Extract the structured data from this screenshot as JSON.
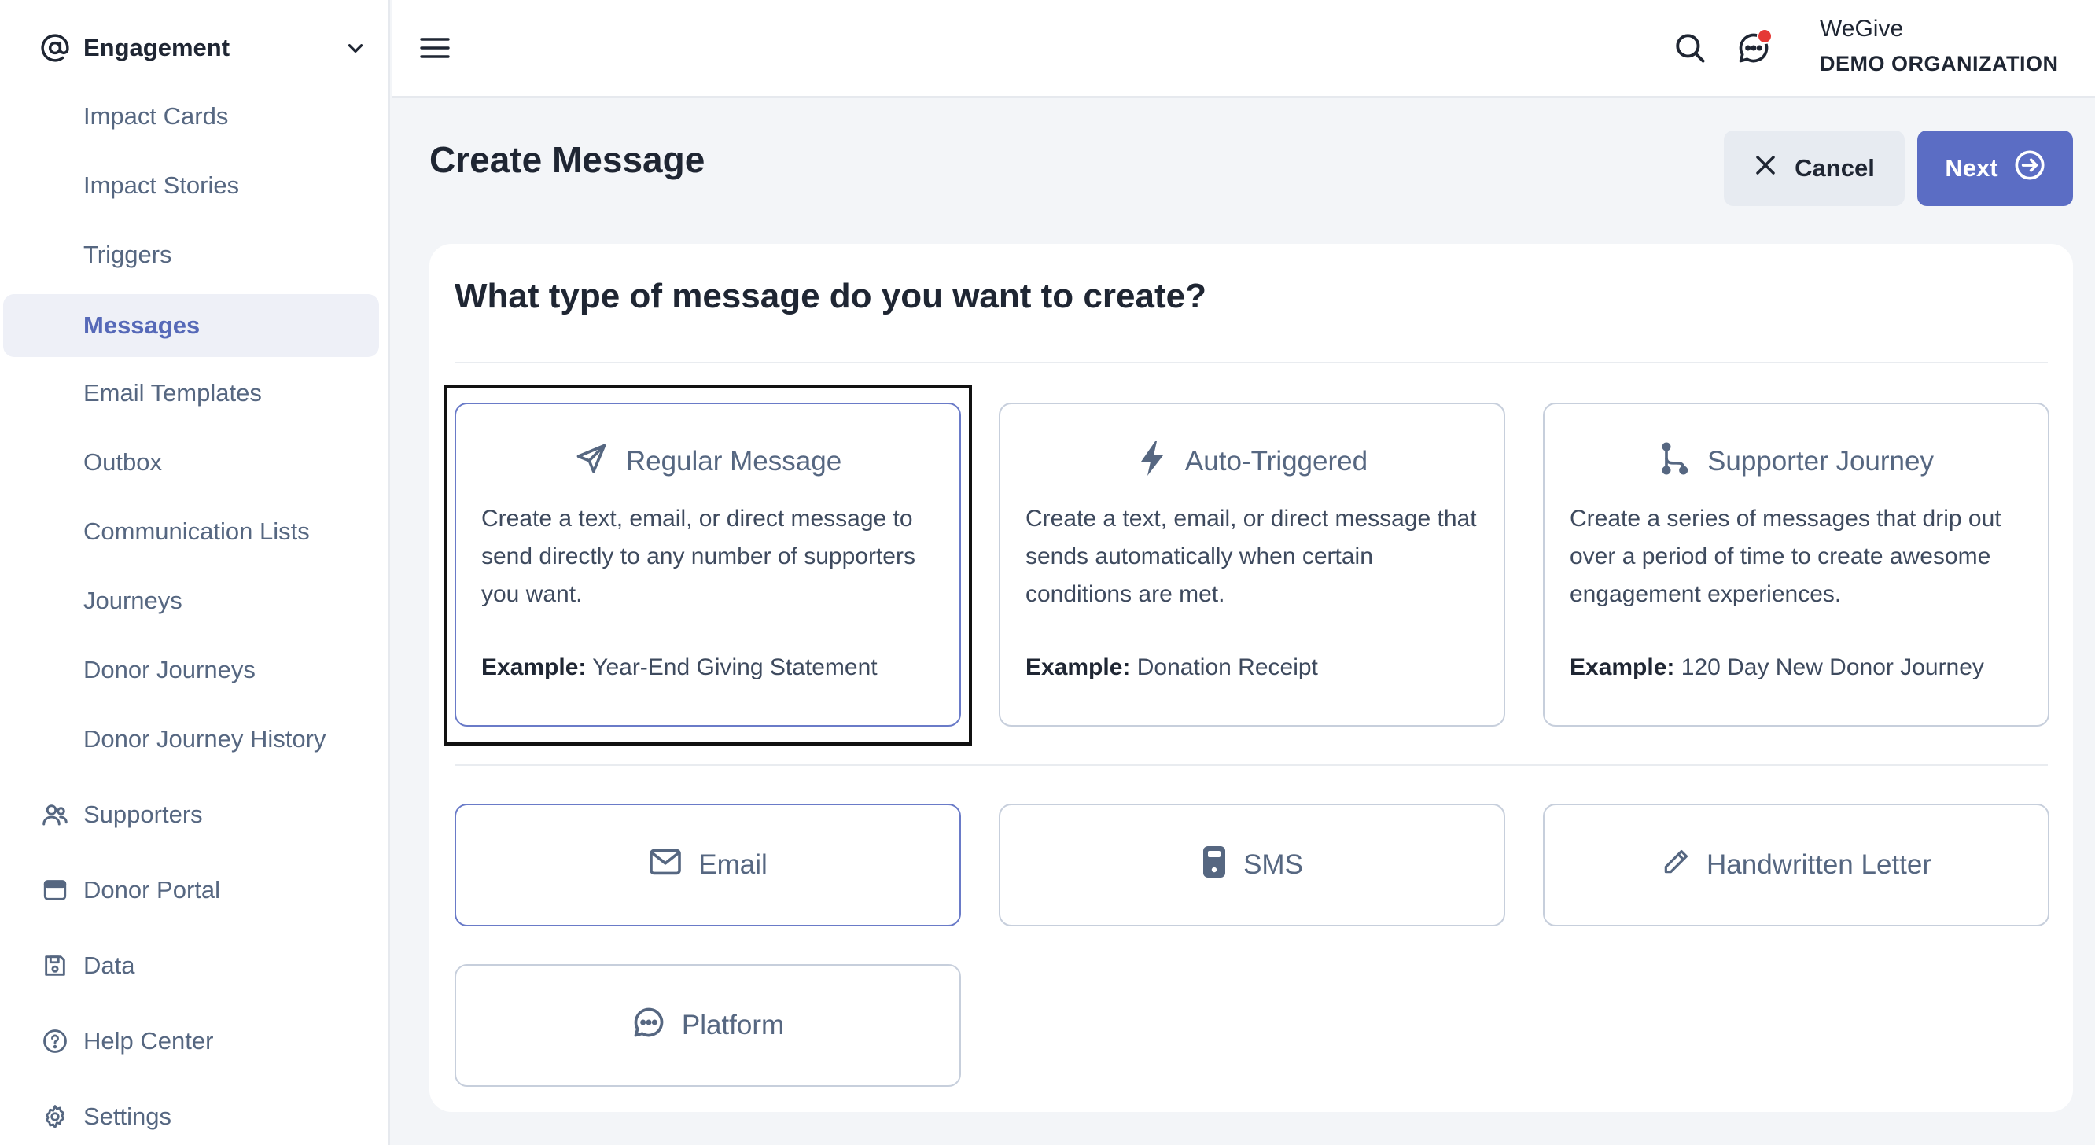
{
  "sidebar": {
    "section": {
      "label": "Engagement",
      "icon": "at-icon"
    },
    "sub_items": [
      {
        "label": "Impact Cards",
        "active": false
      },
      {
        "label": "Impact Stories",
        "active": false
      },
      {
        "label": "Triggers",
        "active": false
      },
      {
        "label": "Messages",
        "active": true
      },
      {
        "label": "Email Templates",
        "active": false
      },
      {
        "label": "Outbox",
        "active": false
      },
      {
        "label": "Communication Lists",
        "active": false
      },
      {
        "label": "Journeys",
        "active": false
      },
      {
        "label": "Donor Journeys",
        "active": false
      },
      {
        "label": "Donor Journey History",
        "active": false
      }
    ],
    "main_items": [
      {
        "label": "Supporters",
        "icon": "users-icon"
      },
      {
        "label": "Donor Portal",
        "icon": "browser-window-icon"
      },
      {
        "label": "Data",
        "icon": "floppy-disk-icon"
      },
      {
        "label": "Help Center",
        "icon": "question-circle-icon"
      },
      {
        "label": "Settings",
        "icon": "gear-icon"
      }
    ]
  },
  "topbar": {
    "org_name": "WeGive",
    "org_sub": "DEMO ORGANIZATION"
  },
  "header": {
    "title": "Create Message",
    "cancel_label": "Cancel",
    "next_label": "Next"
  },
  "card": {
    "question": "What type of message do you want to create?",
    "example_prefix": "Example:",
    "types": [
      {
        "title": "Regular Message",
        "icon": "paper-plane-icon",
        "description": "Create a text, email, or direct message to send directly to any number of supporters you want.",
        "example": "Year-End Giving Statement",
        "selected": true
      },
      {
        "title": "Auto-Triggered",
        "icon": "lightning-bolt-icon",
        "description": "Create a text, email, or direct message that sends automatically when certain conditions are met.",
        "example": "Donation Receipt",
        "selected": false
      },
      {
        "title": "Supporter Journey",
        "icon": "journey-path-icon",
        "description": "Create a series of messages that drip out over a period of time to create awesome engagement experiences.",
        "example": "120 Day New Donor Journey",
        "selected": false
      }
    ],
    "channels": [
      {
        "label": "Email",
        "icon": "envelope-icon",
        "selected": true
      },
      {
        "label": "SMS",
        "icon": "phone-icon",
        "selected": false
      },
      {
        "label": "Handwritten Letter",
        "icon": "pencil-icon",
        "selected": false
      },
      {
        "label": "Platform",
        "icon": "chat-bubble-icon",
        "selected": false
      }
    ]
  },
  "colors": {
    "accent": "#5b6dc4",
    "selected_border": "#6a7bc8",
    "active_nav_bg": "#eef0f7",
    "notification": "#e53935"
  }
}
